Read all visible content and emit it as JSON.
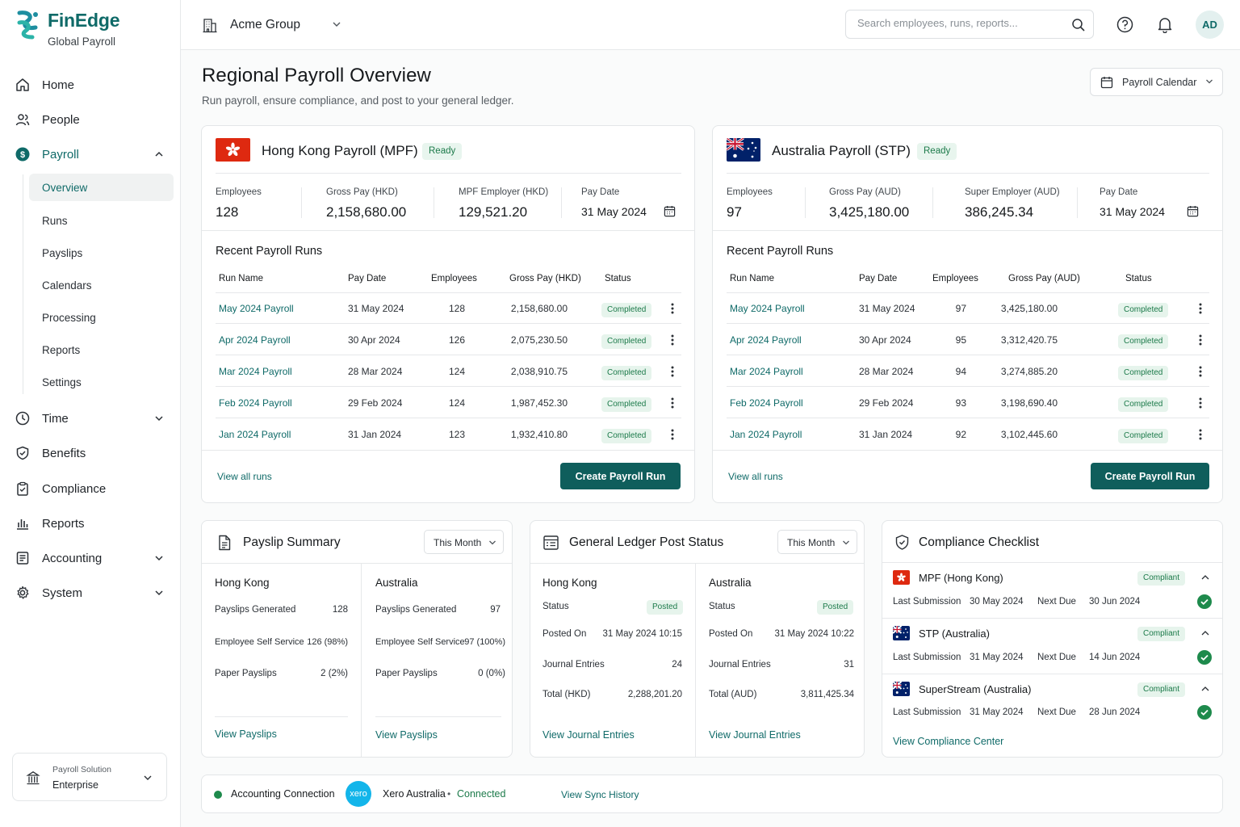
{
  "brand": {
    "name": "FinEdge",
    "subtitle": "Global Payroll"
  },
  "sidebar": {
    "items": [
      {
        "label": "Home",
        "icon": "home-icon"
      },
      {
        "label": "People",
        "icon": "people-icon"
      },
      {
        "label": "Payroll",
        "icon": "dollar-icon",
        "expanded": true
      },
      {
        "label": "Time",
        "icon": "clock-icon"
      },
      {
        "label": "Benefits",
        "icon": "shield-icon"
      },
      {
        "label": "Compliance",
        "icon": "clipboard-icon"
      },
      {
        "label": "Reports",
        "icon": "bar-chart-icon"
      },
      {
        "label": "Accounting",
        "icon": "ledger-icon"
      },
      {
        "label": "System",
        "icon": "gear-icon"
      }
    ],
    "payroll_sub": [
      "Overview",
      "Runs",
      "Payslips",
      "Calendars",
      "Processing",
      "Reports",
      "Settings"
    ],
    "plan": {
      "label": "Payroll Solution",
      "value": "Enterprise"
    }
  },
  "header": {
    "org": "Acme Group",
    "search_placeholder": "Search employees, runs, reports...",
    "avatar": "AD"
  },
  "page": {
    "title": "Regional Payroll Overview",
    "subtitle": "Run payroll, ensure compliance, and post to your general ledger.",
    "calendar_button": "Payroll Calendar"
  },
  "hk": {
    "title": "Hong Kong Payroll (MPF)",
    "status": "Ready",
    "stats": [
      {
        "label": "Employees",
        "value": "128"
      },
      {
        "label": "Gross Pay (HKD)",
        "value": "2,158,680.00"
      },
      {
        "label": "MPF Employer (HKD)",
        "value": "129,521.20"
      },
      {
        "label": "Pay Date",
        "value": "31 May 2024"
      }
    ],
    "runs_title": "Recent Payroll Runs",
    "columns": [
      "Run Name",
      "Pay Date",
      "Employees",
      "Gross Pay (HKD)",
      "Status"
    ],
    "rows": [
      {
        "name": "May 2024 Payroll",
        "date": "31 May 2024",
        "emp": "128",
        "gross": "2,158,680.00",
        "status": "Completed"
      },
      {
        "name": "Apr 2024 Payroll",
        "date": "30 Apr 2024",
        "emp": "126",
        "gross": "2,075,230.50",
        "status": "Completed"
      },
      {
        "name": "Mar 2024 Payroll",
        "date": "28 Mar 2024",
        "emp": "124",
        "gross": "2,038,910.75",
        "status": "Completed"
      },
      {
        "name": "Feb 2024 Payroll",
        "date": "29 Feb 2024",
        "emp": "124",
        "gross": "1,987,452.30",
        "status": "Completed"
      },
      {
        "name": "Jan 2024 Payroll",
        "date": "31 Jan 2024",
        "emp": "123",
        "gross": "1,932,410.80",
        "status": "Completed"
      }
    ],
    "view_all": "View all runs",
    "create": "Create Payroll Run"
  },
  "au": {
    "title": "Australia Payroll (STP)",
    "status": "Ready",
    "stats": [
      {
        "label": "Employees",
        "value": "97"
      },
      {
        "label": "Gross Pay (AUD)",
        "value": "3,425,180.00"
      },
      {
        "label": "Super Employer (AUD)",
        "value": "386,245.34"
      },
      {
        "label": "Pay Date",
        "value": "31 May 2024"
      }
    ],
    "runs_title": "Recent Payroll Runs",
    "columns": [
      "Run Name",
      "Pay Date",
      "Employees",
      "Gross Pay (AUD)",
      "Status"
    ],
    "rows": [
      {
        "name": "May 2024 Payroll",
        "date": "31 May 2024",
        "emp": "97",
        "gross": "3,425,180.00",
        "status": "Completed"
      },
      {
        "name": "Apr 2024 Payroll",
        "date": "30 Apr 2024",
        "emp": "95",
        "gross": "3,312,420.75",
        "status": "Completed"
      },
      {
        "name": "Mar 2024 Payroll",
        "date": "28 Mar 2024",
        "emp": "94",
        "gross": "3,274,885.20",
        "status": "Completed"
      },
      {
        "name": "Feb 2024 Payroll",
        "date": "29 Feb 2024",
        "emp": "93",
        "gross": "3,198,690.40",
        "status": "Completed"
      },
      {
        "name": "Jan 2024 Payroll",
        "date": "31 Jan 2024",
        "emp": "92",
        "gross": "3,102,445.60",
        "status": "Completed"
      }
    ],
    "view_all": "View all runs",
    "create": "Create Payroll Run"
  },
  "payslip": {
    "title": "Payslip Summary",
    "period": "This Month",
    "hk": {
      "region": "Hong Kong",
      "rows": [
        [
          "Payslips Generated",
          "128"
        ],
        [
          "Employee Self Service",
          "126 (98%)"
        ],
        [
          "Paper Payslips",
          "2 (2%)"
        ]
      ],
      "link": "View Payslips"
    },
    "au": {
      "region": "Australia",
      "rows": [
        [
          "Payslips Generated",
          "97"
        ],
        [
          "Employee Self Service",
          "97 (100%)"
        ],
        [
          "Paper Payslips",
          "0 (0%)"
        ]
      ],
      "link": "View Payslips"
    }
  },
  "gl": {
    "title": "General Ledger Post Status",
    "period": "This Month",
    "hk": {
      "region": "Hong Kong",
      "status_label": "Status",
      "status": "Posted",
      "rows": [
        [
          "Posted On",
          "31 May 2024 10:15"
        ],
        [
          "Journal Entries",
          "24"
        ],
        [
          "Total (HKD)",
          "2,288,201.20"
        ]
      ],
      "link": "View Journal Entries"
    },
    "au": {
      "region": "Australia",
      "status_label": "Status",
      "status": "Posted",
      "rows": [
        [
          "Posted On",
          "31 May 2024 10:22"
        ],
        [
          "Journal Entries",
          "31"
        ],
        [
          "Total (AUD)",
          "3,811,425.34"
        ]
      ],
      "link": "View Journal Entries"
    }
  },
  "compliance": {
    "title": "Compliance Checklist",
    "items": [
      {
        "name": "MPF (Hong Kong)",
        "status": "Compliant",
        "last_label": "Last Submission",
        "last": "30 May 2024",
        "next_label": "Next Due",
        "next": "30 Jun 2024"
      },
      {
        "name": "STP (Australia)",
        "status": "Compliant",
        "last_label": "Last Submission",
        "last": "31 May 2024",
        "next_label": "Next Due",
        "next": "14 Jun 2024"
      },
      {
        "name": "SuperStream (Australia)",
        "status": "Compliant",
        "last_label": "Last Submission",
        "last": "31 May 2024",
        "next_label": "Next Due",
        "next": "28 Jun 2024"
      }
    ],
    "link": "View Compliance Center"
  },
  "connection": {
    "label": "Accounting Connection",
    "logo": "xero",
    "provider": "Xero Australia",
    "sep": "•",
    "status": "Connected",
    "link": "View Sync History"
  },
  "colors": {
    "brand": "#0f6a68",
    "button": "#0f5e5c",
    "success": "#1e8a4c",
    "hk_flag": "#de2910",
    "au_flag": "#012169"
  }
}
